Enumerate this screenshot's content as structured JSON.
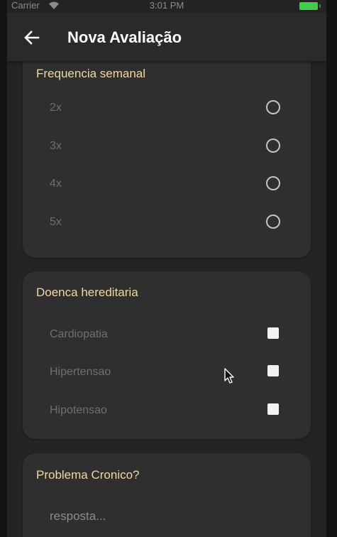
{
  "status_bar": {
    "carrier": "Carrier",
    "time": "3:01 PM",
    "wifi_icon": "wifi-icon",
    "battery_icon": "battery-icon",
    "battery_color": "#3ecf4a"
  },
  "app_bar": {
    "back_icon": "arrow-left-icon",
    "title": "Nova Avaliação"
  },
  "frequency": {
    "title": "Frequencia semanal",
    "options": [
      {
        "label": "2x",
        "selected": false
      },
      {
        "label": "3x",
        "selected": false
      },
      {
        "label": "4x",
        "selected": false
      },
      {
        "label": "5x",
        "selected": false
      }
    ]
  },
  "hereditary": {
    "title": "Doenca hereditaria",
    "options": [
      {
        "label": "Cardiopatia",
        "checked": false
      },
      {
        "label": "Hipertensao",
        "checked": false
      },
      {
        "label": "Hipotensao",
        "checked": false
      }
    ]
  },
  "chronic": {
    "title": "Problema Cronico?",
    "placeholder": "resposta..."
  },
  "colors": {
    "background": "#242424",
    "card": "#2f2f2f",
    "accent_title": "#f0d9a0",
    "option_text": "#6f6f6f"
  }
}
